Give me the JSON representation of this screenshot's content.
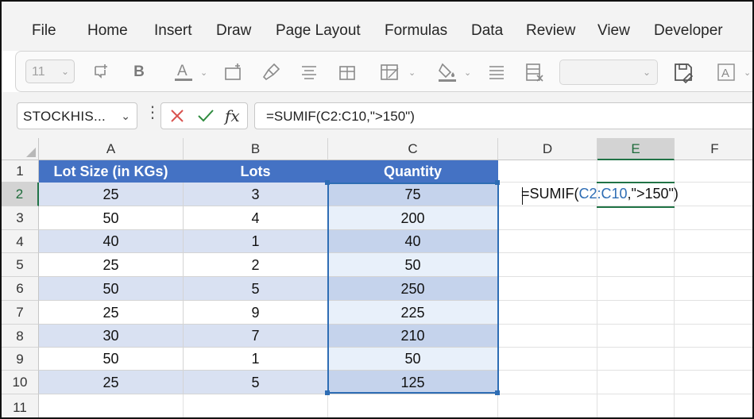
{
  "menu": {
    "items": [
      "File",
      "Home",
      "Insert",
      "Draw",
      "Page Layout",
      "Formulas",
      "Data",
      "Review",
      "View",
      "Developer"
    ]
  },
  "ribbon": {
    "font_size_value": "11",
    "bold_label": "B",
    "font_color_label": "A",
    "style_label": "A"
  },
  "formula_bar": {
    "name_box": "STOCKHIS...",
    "fx_label": "fx",
    "formula": "=SUMIF(C2:C10,\">150\")"
  },
  "sheet": {
    "columns": [
      "A",
      "B",
      "C",
      "D",
      "E",
      "F"
    ],
    "rows": [
      "1",
      "2",
      "3",
      "4",
      "5",
      "6",
      "7",
      "8",
      "9",
      "10",
      "11"
    ],
    "headers": [
      "Lot Size (in KGs)",
      "Lots",
      "Quantity"
    ],
    "data": [
      [
        "25",
        "3",
        "75"
      ],
      [
        "50",
        "4",
        "200"
      ],
      [
        "40",
        "1",
        "40"
      ],
      [
        "25",
        "2",
        "50"
      ],
      [
        "50",
        "5",
        "250"
      ],
      [
        "25",
        "9",
        "225"
      ],
      [
        "30",
        "7",
        "210"
      ],
      [
        "50",
        "1",
        "50"
      ],
      [
        "25",
        "5",
        "125"
      ]
    ],
    "edit_cell": {
      "prefix": "=SUMIF(",
      "ref": "C2:C10",
      "suffix": ",\">150\")"
    }
  },
  "colors": {
    "header_fill": "#4472c4",
    "band_fill": "#d9e1f2",
    "selection": "#2e6db4",
    "active_header": "#217346"
  }
}
